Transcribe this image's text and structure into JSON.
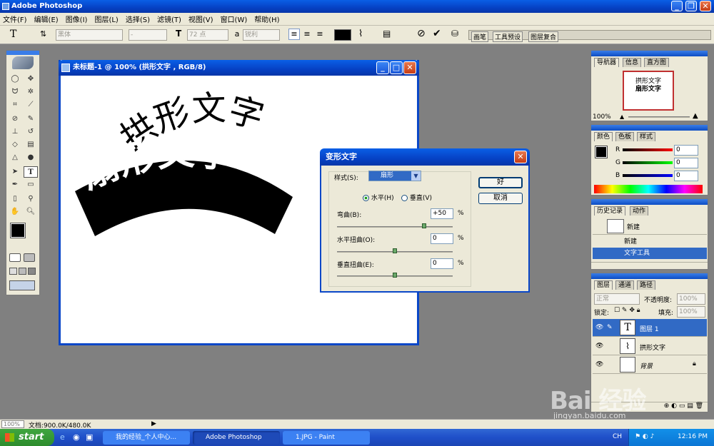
{
  "app": {
    "title": "Adobe Photoshop"
  },
  "menu": [
    "文件(F)",
    "编辑(E)",
    "图像(I)",
    "图层(L)",
    "选择(S)",
    "滤镜(T)",
    "视图(V)",
    "窗口(W)",
    "帮助(H)"
  ],
  "options": {
    "font_family": "黑体",
    "font_style": "-",
    "font_size": "72 点",
    "aa_label": "a",
    "antialias": "锐利",
    "dock_tabs": [
      "画笔",
      "工具预设",
      "图层复合"
    ]
  },
  "document": {
    "title": "未标题-1 @ 100% (拱形文字 , RGB/8)",
    "arch_text": "拱形文字",
    "fan_text": "扇形文字"
  },
  "dialog": {
    "title": "变形文字",
    "style_label": "样式(S):",
    "style_value": "扇形",
    "horizontal": "水平(H)",
    "vertical": "垂直(V)",
    "bend_label": "弯曲(B):",
    "bend_value": "+50",
    "hdist_label": "水平扭曲(O):",
    "hdist_value": "0",
    "vdist_label": "垂直扭曲(E):",
    "vdist_value": "0",
    "pct": "%",
    "ok": "好",
    "cancel": "取消",
    "bend_fraction": 0.75,
    "hdist_fraction": 0.5,
    "vdist_fraction": 0.5
  },
  "navigator": {
    "tabs": [
      "导航器",
      "信息",
      "直方图"
    ],
    "zoom": "100%",
    "thumb_arch": "拱形文字",
    "thumb_fan": "扇形文字"
  },
  "color": {
    "tabs": [
      "颜色",
      "色板",
      "样式"
    ],
    "r_label": "R",
    "g_label": "G",
    "b_label": "B",
    "r": "0",
    "g": "0",
    "b": "0"
  },
  "history": {
    "tabs": [
      "历史记录",
      "动作"
    ],
    "snapshot": "新建",
    "items": [
      "新建",
      "文字工具"
    ]
  },
  "layers": {
    "tabs": [
      "图层",
      "通道",
      "路径"
    ],
    "blend": "正常",
    "opacity_label": "不透明度:",
    "opacity": "100%",
    "lock_label": "锁定:",
    "fill_label": "填充:",
    "fill": "100%",
    "rows": [
      "图层 1",
      "拱形文字",
      "背景"
    ]
  },
  "status": {
    "zoom": "100%",
    "doc": "文档:900.0K/480.0K"
  },
  "taskbar": {
    "start": "start",
    "tasks": [
      "我的经验_个人中心...",
      "Adobe Photoshop",
      "1.JPG - Paint"
    ],
    "lang": "CH",
    "clock": "12:16 PM"
  },
  "watermark": {
    "logo": "Bai 经验",
    "url": "jingyan.baidu.com"
  },
  "colors": {
    "xp_blue": "#0a47c8",
    "selected": "#316ac5",
    "foreground": "#000000",
    "background_swatch": "#ffffff"
  },
  "icons": [
    "minimize-icon",
    "maximize-icon",
    "close-icon",
    "text-tool-icon",
    "eye-icon",
    "lock-icon",
    "cancel-icon",
    "commit-icon"
  ]
}
